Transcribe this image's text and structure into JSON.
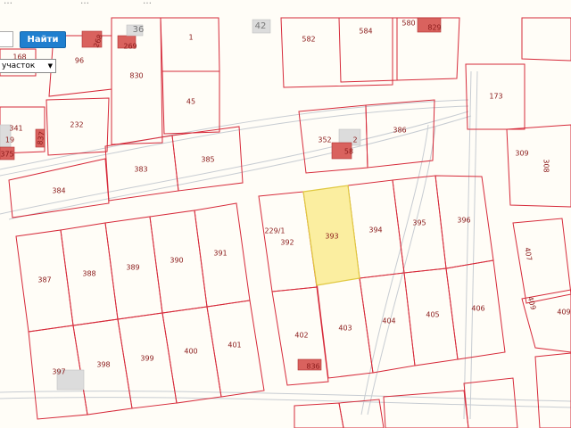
{
  "search": {
    "button_label": "Найти",
    "input_value": "",
    "placeholder": ""
  },
  "filter": {
    "selected": "участок",
    "options": [
      "участок"
    ]
  },
  "top_fragments": [
    "…",
    "…",
    "…"
  ],
  "map": {
    "selected_plot": "393",
    "colors": {
      "boundary": "#d62a3a",
      "selected_fill": "#fbeea0",
      "road": "#c7ccd2",
      "building": "#d9625e"
    },
    "labels": {
      "p168": "168",
      "p96": "96",
      "p36": "36",
      "p1": "1",
      "p42": "42",
      "p582": "582",
      "p584": "584",
      "p580": "580",
      "p829": "829",
      "p830": "830",
      "p45": "45",
      "p173": "173",
      "p341": "341",
      "p19": "19",
      "p375": "375",
      "p837": "837",
      "p232": "232",
      "p352": "352",
      "p386": "386",
      "p309": "309",
      "p308": "308",
      "p383": "383",
      "p385": "385",
      "p384": "384",
      "p2291": "229/1",
      "p392": "392",
      "p393": "393",
      "p394": "394",
      "p395": "395",
      "p396": "396",
      "p387": "387",
      "p388": "388",
      "p389": "389",
      "p390": "390",
      "p391": "391",
      "p407": "407",
      "p402": "402",
      "p403": "403",
      "p404": "404",
      "p405": "405",
      "p406": "406",
      "p409": "409",
      "p397": "397",
      "p398": "398",
      "p399": "399",
      "p400": "400",
      "p401": "401",
      "p836": "836",
      "p268": "268",
      "p269": "269",
      "p2": "2",
      "p58": "58"
    }
  }
}
